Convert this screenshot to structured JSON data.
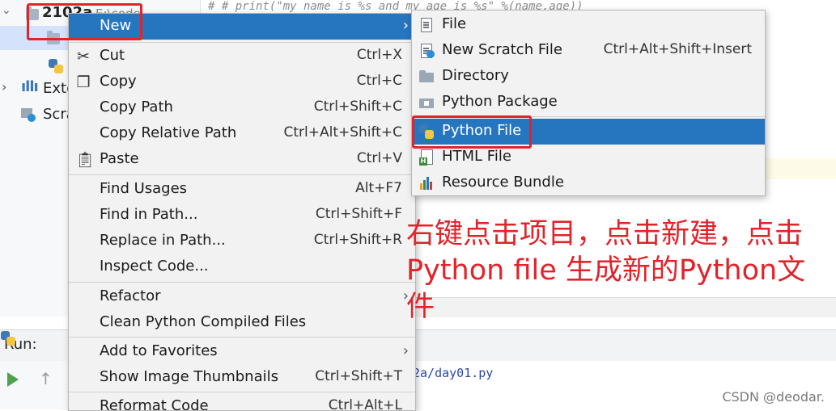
{
  "project_pane": {
    "root_name": "2102a",
    "root_path": "E:\\code",
    "ext_label": "Exte",
    "scratch_label": "Scra"
  },
  "editor": {
    "code_line": "#  #         print(\"my name is %s and my age is %s\" %(name,age))"
  },
  "context_menu": {
    "items": [
      {
        "label": "New",
        "shortcut": "",
        "submenu": true,
        "icon": "none"
      },
      {
        "label": "Cut",
        "shortcut": "Ctrl+X",
        "icon": "scissors-icon"
      },
      {
        "label": "Copy",
        "shortcut": "Ctrl+C",
        "icon": "copy-icon"
      },
      {
        "label": "Copy Path",
        "shortcut": "Ctrl+Shift+C",
        "icon": "none"
      },
      {
        "label": "Copy Relative Path",
        "shortcut": "Ctrl+Alt+Shift+C",
        "icon": "none"
      },
      {
        "label": "Paste",
        "shortcut": "Ctrl+V",
        "icon": "paste-icon"
      },
      {
        "label": "Find Usages",
        "shortcut": "Alt+F7",
        "icon": "none"
      },
      {
        "label": "Find in Path...",
        "shortcut": "Ctrl+Shift+F",
        "icon": "none"
      },
      {
        "label": "Replace in Path...",
        "shortcut": "Ctrl+Shift+R",
        "icon": "none"
      },
      {
        "label": "Inspect Code...",
        "shortcut": "",
        "icon": "none"
      },
      {
        "label": "Refactor",
        "shortcut": "",
        "submenu": true,
        "icon": "none"
      },
      {
        "label": "Clean Python Compiled Files",
        "shortcut": "",
        "icon": "none"
      },
      {
        "label": "Add to Favorites",
        "shortcut": "",
        "submenu": true,
        "icon": "none"
      },
      {
        "label": "Show Image Thumbnails",
        "shortcut": "Ctrl+Shift+T",
        "icon": "none"
      },
      {
        "label": "Reformat Code",
        "shortcut": "Ctrl+Alt+L",
        "icon": "none"
      }
    ]
  },
  "new_submenu": {
    "items": [
      {
        "label": "File",
        "shortcut": "",
        "icon": "file-icon"
      },
      {
        "label": "New Scratch File",
        "shortcut": "Ctrl+Alt+Shift+Insert",
        "icon": "scratch-file-icon"
      },
      {
        "label": "Directory",
        "shortcut": "",
        "icon": "folder-icon"
      },
      {
        "label": "Python Package",
        "shortcut": "",
        "icon": "package-icon"
      },
      {
        "label": "Python File",
        "shortcut": "",
        "icon": "python-file-icon"
      },
      {
        "label": "HTML File",
        "shortcut": "",
        "icon": "html-file-icon"
      },
      {
        "label": "Resource Bundle",
        "shortcut": "",
        "icon": "resource-bundle-icon"
      }
    ]
  },
  "run_panel": {
    "label": "Run:",
    "console_path": "2a/day01.py"
  },
  "annotation": {
    "text": "右键点击项目，点击新建，点击Python file 生成新的Python文件",
    "color": "#e3222a"
  },
  "watermark": "CSDN @deodar.",
  "colors": {
    "menu_highlight": "#2675bf",
    "annotation_red": "#e3222a"
  }
}
